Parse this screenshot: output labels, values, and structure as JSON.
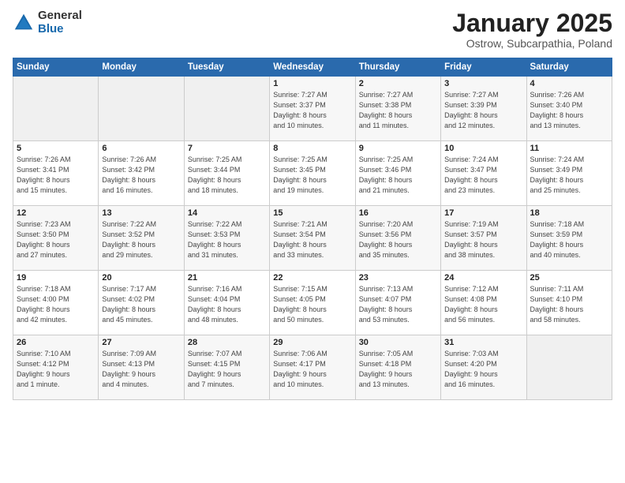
{
  "logo": {
    "general": "General",
    "blue": "Blue"
  },
  "title": "January 2025",
  "subtitle": "Ostrow, Subcarpathia, Poland",
  "days_header": [
    "Sunday",
    "Monday",
    "Tuesday",
    "Wednesday",
    "Thursday",
    "Friday",
    "Saturday"
  ],
  "weeks": [
    [
      {
        "num": "",
        "info": ""
      },
      {
        "num": "",
        "info": ""
      },
      {
        "num": "",
        "info": ""
      },
      {
        "num": "1",
        "info": "Sunrise: 7:27 AM\nSunset: 3:37 PM\nDaylight: 8 hours\nand 10 minutes."
      },
      {
        "num": "2",
        "info": "Sunrise: 7:27 AM\nSunset: 3:38 PM\nDaylight: 8 hours\nand 11 minutes."
      },
      {
        "num": "3",
        "info": "Sunrise: 7:27 AM\nSunset: 3:39 PM\nDaylight: 8 hours\nand 12 minutes."
      },
      {
        "num": "4",
        "info": "Sunrise: 7:26 AM\nSunset: 3:40 PM\nDaylight: 8 hours\nand 13 minutes."
      }
    ],
    [
      {
        "num": "5",
        "info": "Sunrise: 7:26 AM\nSunset: 3:41 PM\nDaylight: 8 hours\nand 15 minutes."
      },
      {
        "num": "6",
        "info": "Sunrise: 7:26 AM\nSunset: 3:42 PM\nDaylight: 8 hours\nand 16 minutes."
      },
      {
        "num": "7",
        "info": "Sunrise: 7:25 AM\nSunset: 3:44 PM\nDaylight: 8 hours\nand 18 minutes."
      },
      {
        "num": "8",
        "info": "Sunrise: 7:25 AM\nSunset: 3:45 PM\nDaylight: 8 hours\nand 19 minutes."
      },
      {
        "num": "9",
        "info": "Sunrise: 7:25 AM\nSunset: 3:46 PM\nDaylight: 8 hours\nand 21 minutes."
      },
      {
        "num": "10",
        "info": "Sunrise: 7:24 AM\nSunset: 3:47 PM\nDaylight: 8 hours\nand 23 minutes."
      },
      {
        "num": "11",
        "info": "Sunrise: 7:24 AM\nSunset: 3:49 PM\nDaylight: 8 hours\nand 25 minutes."
      }
    ],
    [
      {
        "num": "12",
        "info": "Sunrise: 7:23 AM\nSunset: 3:50 PM\nDaylight: 8 hours\nand 27 minutes."
      },
      {
        "num": "13",
        "info": "Sunrise: 7:22 AM\nSunset: 3:52 PM\nDaylight: 8 hours\nand 29 minutes."
      },
      {
        "num": "14",
        "info": "Sunrise: 7:22 AM\nSunset: 3:53 PM\nDaylight: 8 hours\nand 31 minutes."
      },
      {
        "num": "15",
        "info": "Sunrise: 7:21 AM\nSunset: 3:54 PM\nDaylight: 8 hours\nand 33 minutes."
      },
      {
        "num": "16",
        "info": "Sunrise: 7:20 AM\nSunset: 3:56 PM\nDaylight: 8 hours\nand 35 minutes."
      },
      {
        "num": "17",
        "info": "Sunrise: 7:19 AM\nSunset: 3:57 PM\nDaylight: 8 hours\nand 38 minutes."
      },
      {
        "num": "18",
        "info": "Sunrise: 7:18 AM\nSunset: 3:59 PM\nDaylight: 8 hours\nand 40 minutes."
      }
    ],
    [
      {
        "num": "19",
        "info": "Sunrise: 7:18 AM\nSunset: 4:00 PM\nDaylight: 8 hours\nand 42 minutes."
      },
      {
        "num": "20",
        "info": "Sunrise: 7:17 AM\nSunset: 4:02 PM\nDaylight: 8 hours\nand 45 minutes."
      },
      {
        "num": "21",
        "info": "Sunrise: 7:16 AM\nSunset: 4:04 PM\nDaylight: 8 hours\nand 48 minutes."
      },
      {
        "num": "22",
        "info": "Sunrise: 7:15 AM\nSunset: 4:05 PM\nDaylight: 8 hours\nand 50 minutes."
      },
      {
        "num": "23",
        "info": "Sunrise: 7:13 AM\nSunset: 4:07 PM\nDaylight: 8 hours\nand 53 minutes."
      },
      {
        "num": "24",
        "info": "Sunrise: 7:12 AM\nSunset: 4:08 PM\nDaylight: 8 hours\nand 56 minutes."
      },
      {
        "num": "25",
        "info": "Sunrise: 7:11 AM\nSunset: 4:10 PM\nDaylight: 8 hours\nand 58 minutes."
      }
    ],
    [
      {
        "num": "26",
        "info": "Sunrise: 7:10 AM\nSunset: 4:12 PM\nDaylight: 9 hours\nand 1 minute."
      },
      {
        "num": "27",
        "info": "Sunrise: 7:09 AM\nSunset: 4:13 PM\nDaylight: 9 hours\nand 4 minutes."
      },
      {
        "num": "28",
        "info": "Sunrise: 7:07 AM\nSunset: 4:15 PM\nDaylight: 9 hours\nand 7 minutes."
      },
      {
        "num": "29",
        "info": "Sunrise: 7:06 AM\nSunset: 4:17 PM\nDaylight: 9 hours\nand 10 minutes."
      },
      {
        "num": "30",
        "info": "Sunrise: 7:05 AM\nSunset: 4:18 PM\nDaylight: 9 hours\nand 13 minutes."
      },
      {
        "num": "31",
        "info": "Sunrise: 7:03 AM\nSunset: 4:20 PM\nDaylight: 9 hours\nand 16 minutes."
      },
      {
        "num": "",
        "info": ""
      }
    ]
  ]
}
